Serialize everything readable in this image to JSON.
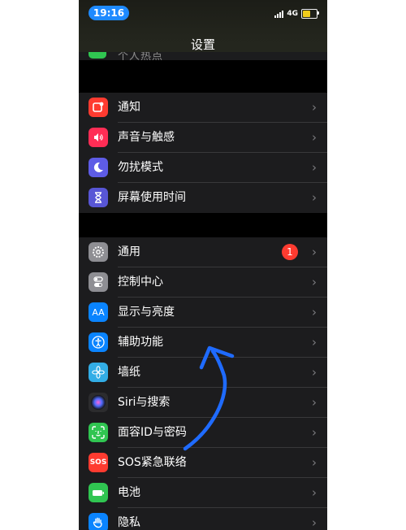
{
  "status_bar": {
    "time": "19:16",
    "network": "4G"
  },
  "nav": {
    "title": "设置"
  },
  "peek_label": "个人热点",
  "group1": [
    {
      "key": "notifications",
      "label": "通知",
      "icon": "notifications-icon",
      "color": "#ff3b30"
    },
    {
      "key": "sounds",
      "label": "声音与触感",
      "icon": "sound-icon",
      "color": "#ff2d55"
    },
    {
      "key": "dnd",
      "label": "勿扰模式",
      "icon": "moon-icon",
      "color": "#5e5ce6"
    },
    {
      "key": "screentime",
      "label": "屏幕使用时间",
      "icon": "hourglass-icon",
      "color": "#5856d6"
    }
  ],
  "group2": [
    {
      "key": "general",
      "label": "通用",
      "icon": "gear-icon",
      "color": "#8e8e93",
      "badge": "1"
    },
    {
      "key": "control-center",
      "label": "控制中心",
      "icon": "toggle-icon",
      "color": "#8e8e93"
    },
    {
      "key": "display",
      "label": "显示与亮度",
      "icon": "text-size-icon",
      "icon_text": "AA",
      "color": "#0a84ff"
    },
    {
      "key": "accessibility",
      "label": "辅助功能",
      "icon": "accessibility-icon",
      "color": "#0a84ff"
    },
    {
      "key": "wallpaper",
      "label": "墙纸",
      "icon": "flower-icon",
      "color": "#32ade6"
    },
    {
      "key": "siri",
      "label": "Siri与搜索",
      "icon": "siri-icon",
      "color": "#2c2c2e"
    },
    {
      "key": "faceid",
      "label": "面容ID与密码",
      "icon": "face-id-icon",
      "color": "#30c551"
    },
    {
      "key": "sos",
      "label": "SOS紧急联络",
      "icon": "sos-icon",
      "icon_text": "SOS",
      "color": "#ff3b30"
    },
    {
      "key": "battery",
      "label": "电池",
      "icon": "battery-icon",
      "color": "#30c551"
    },
    {
      "key": "privacy",
      "label": "隐私",
      "icon": "hand-icon",
      "color": "#0a84ff"
    }
  ],
  "colors": {
    "accent_arrow": "#1f6bff",
    "badge": "#ff3b30",
    "cell": "#1c1c1e"
  }
}
